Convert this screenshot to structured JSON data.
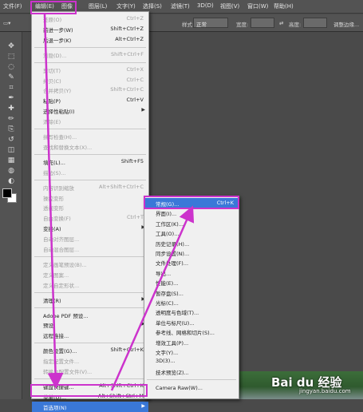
{
  "menubar": {
    "items": [
      "文件(F)",
      "编辑(E)",
      "图像",
      "图层(L)",
      "文字(Y)",
      "选择(S)",
      "滤镜(T)",
      "3D(D)",
      "视图(V)",
      "窗口(W)",
      "帮助(H)"
    ],
    "active": "编辑(E)"
  },
  "options_bar": {
    "style_label": "样式:",
    "style_value": "正常",
    "width_label": "宽度:",
    "height_label": "高度:",
    "refine_label": "调整边缘..."
  },
  "toolbar": {
    "icons": [
      "move-icon",
      "marquee-icon",
      "lasso-icon",
      "quick-select-icon",
      "crop-icon",
      "eyedropper-icon",
      "healing-brush-icon",
      "brush-icon",
      "clone-stamp-icon",
      "history-brush-icon",
      "eraser-icon",
      "gradient-icon",
      "blur-icon",
      "dodge-icon",
      "pen-icon",
      "type-icon",
      "path-select-icon",
      "shape-icon",
      "hand-icon",
      "zoom-icon"
    ]
  },
  "edit_menu": {
    "items": [
      {
        "label": "还原(O)",
        "shortcut": "Ctrl+Z",
        "disabled": true
      },
      {
        "label": "前进一步(W)",
        "shortcut": "Shift+Ctrl+Z",
        "disabled": false
      },
      {
        "label": "后退一步(K)",
        "shortcut": "Alt+Ctrl+Z",
        "disabled": false
      },
      {
        "sep": true
      },
      {
        "label": "渐隐(D)...",
        "shortcut": "Shift+Ctrl+F",
        "disabled": true
      },
      {
        "sep": true
      },
      {
        "label": "剪切(T)",
        "shortcut": "Ctrl+X",
        "disabled": true
      },
      {
        "label": "拷贝(C)",
        "shortcut": "Ctrl+C",
        "disabled": true
      },
      {
        "label": "合并拷贝(Y)",
        "shortcut": "Shift+Ctrl+C",
        "disabled": true
      },
      {
        "label": "粘贴(P)",
        "shortcut": "Ctrl+V",
        "disabled": false
      },
      {
        "label": "选择性粘贴(I)",
        "shortcut": "",
        "disabled": false,
        "submenu": true
      },
      {
        "label": "清除(E)",
        "shortcut": "",
        "disabled": true
      },
      {
        "sep": true
      },
      {
        "label": "拼写检查(H)...",
        "shortcut": "",
        "disabled": true
      },
      {
        "label": "查找和替换文本(X)...",
        "shortcut": "",
        "disabled": true
      },
      {
        "sep": true
      },
      {
        "label": "填充(L)...",
        "shortcut": "Shift+F5",
        "disabled": false
      },
      {
        "label": "描边(S)...",
        "shortcut": "",
        "disabled": true
      },
      {
        "sep": true
      },
      {
        "label": "内容识别缩放",
        "shortcut": "Alt+Shift+Ctrl+C",
        "disabled": true
      },
      {
        "label": "操控变形",
        "shortcut": "",
        "disabled": true
      },
      {
        "label": "透视变形",
        "shortcut": "",
        "disabled": true
      },
      {
        "label": "自由变换(F)",
        "shortcut": "Ctrl+T",
        "disabled": true
      },
      {
        "label": "变换(A)",
        "shortcut": "",
        "disabled": false,
        "submenu": true
      },
      {
        "label": "自动对齐图层...",
        "shortcut": "",
        "disabled": true
      },
      {
        "label": "自动混合图层...",
        "shortcut": "",
        "disabled": true
      },
      {
        "sep": true
      },
      {
        "label": "定义画笔预设(B)...",
        "shortcut": "",
        "disabled": true
      },
      {
        "label": "定义图案...",
        "shortcut": "",
        "disabled": true
      },
      {
        "label": "定义自定形状...",
        "shortcut": "",
        "disabled": true
      },
      {
        "sep": true
      },
      {
        "label": "清理(R)",
        "shortcut": "",
        "disabled": false,
        "submenu": true
      },
      {
        "sep": true
      },
      {
        "label": "Adobe PDF 预设...",
        "shortcut": "",
        "disabled": false
      },
      {
        "label": "预设",
        "shortcut": "",
        "disabled": false,
        "submenu": true
      },
      {
        "label": "远程连接...",
        "shortcut": "",
        "disabled": false
      },
      {
        "sep": true
      },
      {
        "label": "颜色设置(G)...",
        "shortcut": "Shift+Ctrl+K",
        "disabled": false
      },
      {
        "label": "指定配置文件...",
        "shortcut": "",
        "disabled": true
      },
      {
        "label": "转换为配置文件(V)...",
        "shortcut": "",
        "disabled": true
      },
      {
        "sep": true
      },
      {
        "label": "键盘快捷键...",
        "shortcut": "Alt+Shift+Ctrl+K",
        "disabled": false
      },
      {
        "label": "菜单(U)...",
        "shortcut": "Alt+Shift+Ctrl+M",
        "disabled": false
      },
      {
        "label": "首选项(N)",
        "shortcut": "",
        "disabled": false,
        "submenu": true,
        "highlighted": true
      }
    ]
  },
  "preferences_menu": {
    "items": [
      {
        "label": "常规(G)...",
        "shortcut": "Ctrl+K",
        "highlighted": true
      },
      {
        "label": "界面(I)..."
      },
      {
        "label": "工作区(K)..."
      },
      {
        "label": "工具(O)..."
      },
      {
        "label": "历史记录(H)..."
      },
      {
        "label": "同步设置(N)..."
      },
      {
        "label": "文件处理(F)..."
      },
      {
        "label": "导出..."
      },
      {
        "label": "性能(E)..."
      },
      {
        "label": "暂存盘(S)..."
      },
      {
        "label": "光标(C)..."
      },
      {
        "label": "透明度与色域(T)..."
      },
      {
        "label": "单位与标尺(U)..."
      },
      {
        "label": "参考线、网格和切片(S)..."
      },
      {
        "label": "增效工具(P)..."
      },
      {
        "label": "文字(Y)..."
      },
      {
        "label": "3D(3)..."
      },
      {
        "label": "技术预览(Z)..."
      },
      {
        "sep": true
      },
      {
        "label": "Camera Raw(W)..."
      }
    ]
  },
  "watermark": {
    "brand": "Bai du 经验",
    "url": "jingyan.baidu.com"
  },
  "colors": {
    "highlight": "#3a78d8",
    "annotation": "#cc33cc",
    "menu_bg": "#f0f0f0",
    "chrome": "#535353"
  }
}
